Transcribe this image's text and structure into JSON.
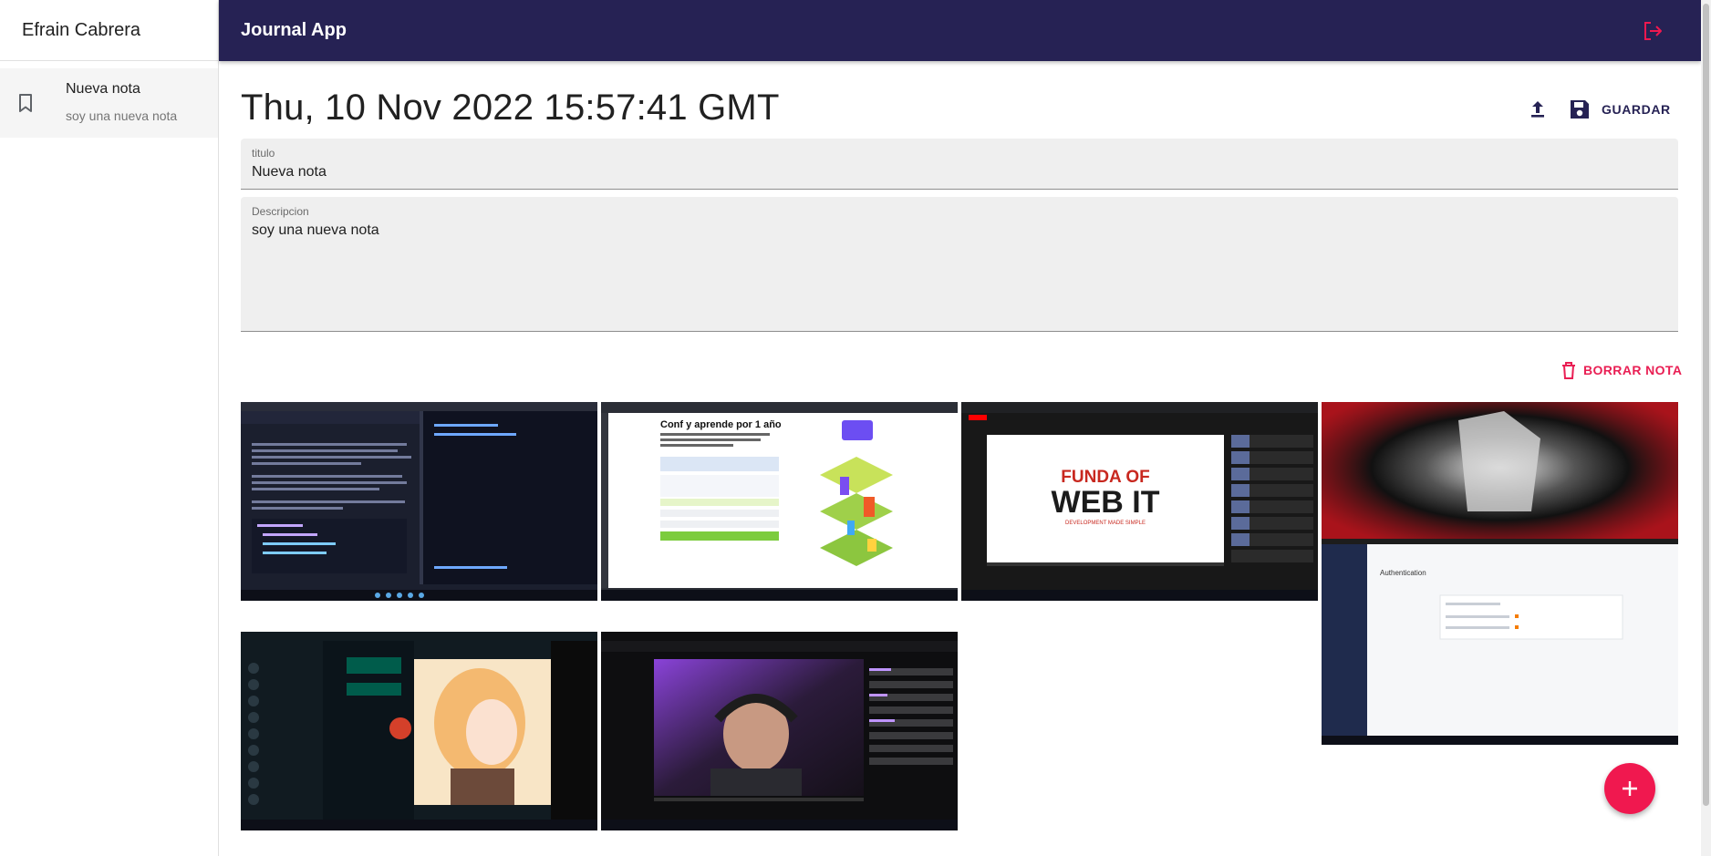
{
  "sidebar": {
    "user_name": "Efrain Cabrera",
    "notes": [
      {
        "title": "Nueva nota",
        "body": "soy una nueva nota"
      }
    ]
  },
  "appbar": {
    "title": "Journal App"
  },
  "note": {
    "date": "Thu, 10 Nov 2022 15:57:41 GMT",
    "save_label": "GUARDAR",
    "delete_label": "BORRAR NOTA",
    "title_label": "titulo",
    "title_value": "Nueva nota",
    "desc_label": "Descripcion",
    "desc_value": "soy una nueva nota"
  },
  "gallery": {
    "images": [
      {
        "kind": "code-editor"
      },
      {
        "kind": "conf-landing",
        "heading": "Conf y aprende por 1 año"
      },
      {
        "kind": "youtube-video",
        "text_line1": "FUNDA OF",
        "text_line2": "WEB IT",
        "tagline": "DEVELOPMENT MADE SIMPLE"
      },
      {
        "kind": "anime-firebase",
        "panel_title": "Authentication"
      },
      {
        "kind": "whatsapp-anime"
      },
      {
        "kind": "twitch-stream"
      }
    ]
  },
  "colors": {
    "primary": "#262254",
    "accent": "#f0184f",
    "danger": "#e91e53"
  },
  "icons": {
    "bookmark": "bookmark-icon",
    "logout": "logout-icon",
    "upload": "upload-icon",
    "save": "save-icon",
    "delete": "trash-icon",
    "add": "add-icon"
  }
}
